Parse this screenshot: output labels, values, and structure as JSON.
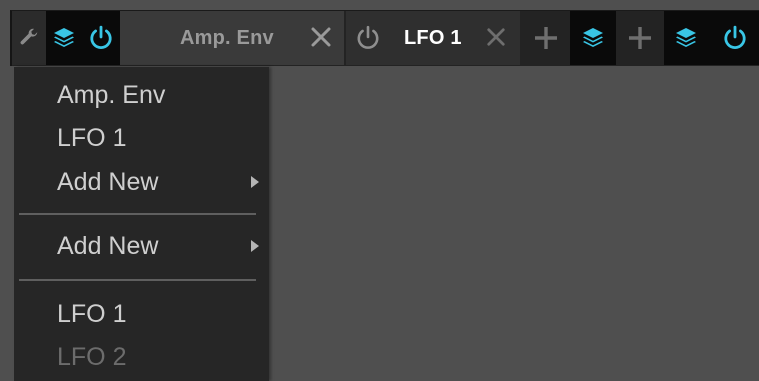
{
  "toolbar": {
    "tabs": [
      {
        "label": "Amp. Env",
        "power_icon": "power-icon",
        "close_icon": "close-icon"
      },
      {
        "label": "LFO 1",
        "power_icon": "power-icon",
        "close_icon": "close-icon"
      }
    ],
    "icons": {
      "settings": "wrench-icon",
      "layers": "layers-icon",
      "add": "plus-icon",
      "power": "power-icon"
    },
    "colors": {
      "accent": "#39c6e6",
      "active_tab_text": "#ffffff",
      "inactive_tab_text": "#9a9a9a"
    }
  },
  "menu": {
    "items": [
      {
        "label": "Amp. Env",
        "enabled": true
      },
      {
        "label": "LFO 1",
        "enabled": true
      },
      {
        "label": "Add New",
        "enabled": true,
        "submenu": true
      }
    ],
    "add_section": {
      "label": "Add New",
      "submenu": true
    },
    "bottom_items": [
      {
        "label": "LFO 1",
        "enabled": true
      },
      {
        "label": "LFO 2",
        "enabled": false
      }
    ]
  }
}
